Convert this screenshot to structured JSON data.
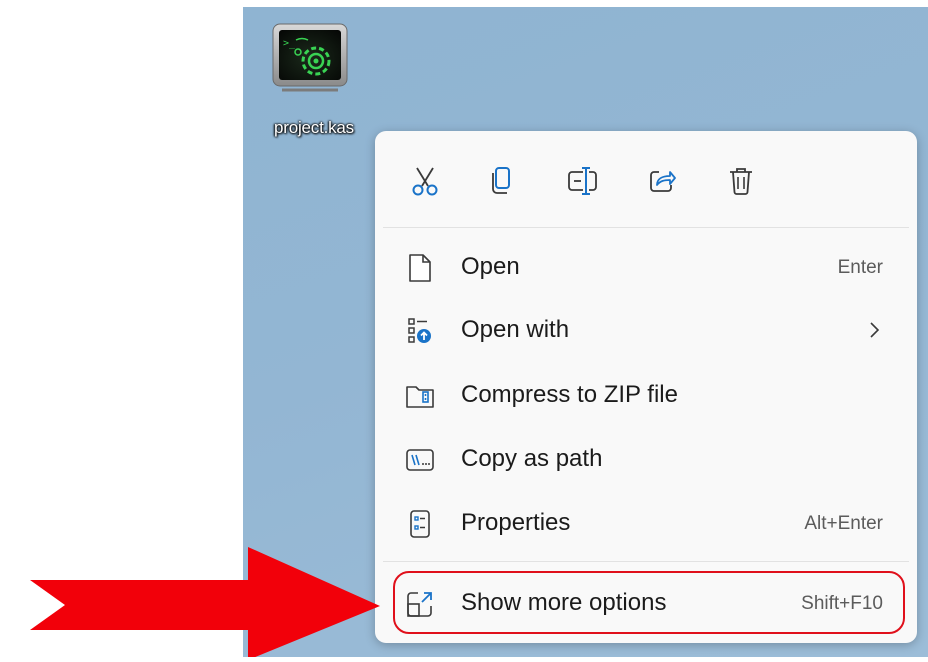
{
  "desktop": {
    "file_icon_label": "project.kas",
    "file_icon_name": "terminal-file-icon"
  },
  "toolbar": {
    "buttons": [
      {
        "name": "cut",
        "icon": "scissors-icon"
      },
      {
        "name": "copy",
        "icon": "copy-icon"
      },
      {
        "name": "rename",
        "icon": "rename-icon"
      },
      {
        "name": "share",
        "icon": "share-icon"
      },
      {
        "name": "delete",
        "icon": "trash-icon"
      }
    ],
    "accent_color": "#1a73c8"
  },
  "menu": {
    "items": [
      {
        "label": "Open",
        "shortcut": "Enter",
        "icon": "document-icon"
      },
      {
        "label": "Open with",
        "shortcut": "",
        "icon": "open-with-icon",
        "has_submenu": true
      },
      {
        "label": "Compress to ZIP file",
        "shortcut": "",
        "icon": "zip-icon"
      },
      {
        "label": "Copy as path",
        "shortcut": "",
        "icon": "path-icon"
      },
      {
        "label": "Properties",
        "shortcut": "Alt+Enter",
        "icon": "properties-icon"
      },
      {
        "label": "Show more options",
        "shortcut": "Shift+F10",
        "icon": "more-options-icon",
        "highlighted": true
      }
    ]
  },
  "annotation": {
    "highlight_color": "#e0101b",
    "arrow_color": "#f2000a"
  }
}
